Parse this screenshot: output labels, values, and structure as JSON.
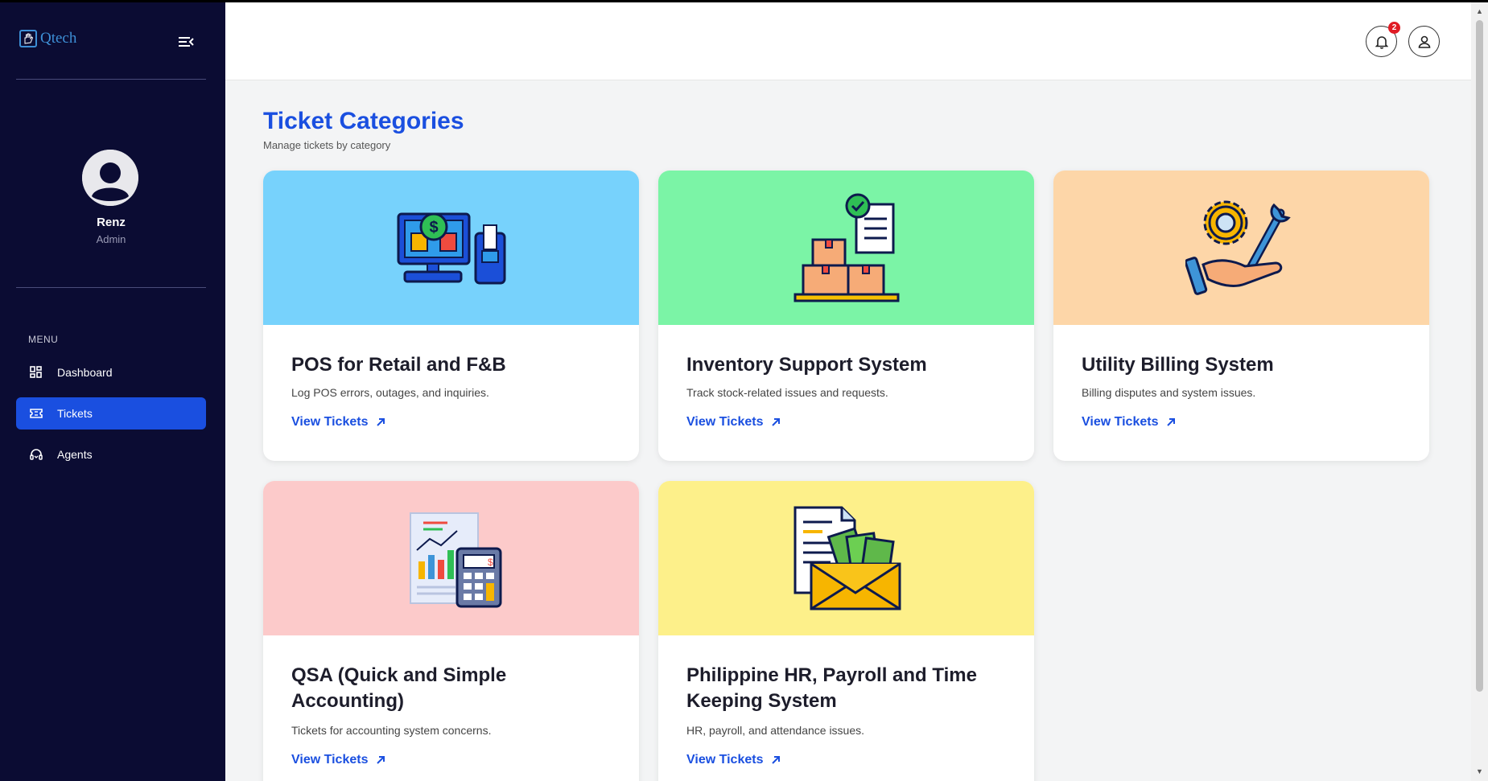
{
  "app": {
    "logo_text": "Qtech"
  },
  "user": {
    "name": "Renz",
    "role": "Admin"
  },
  "menu": {
    "label": "MENU",
    "items": [
      {
        "label": "Dashboard",
        "icon": "grid-icon",
        "active": false
      },
      {
        "label": "Tickets",
        "icon": "ticket-icon",
        "active": true
      },
      {
        "label": "Agents",
        "icon": "headset-icon",
        "active": false
      }
    ]
  },
  "topbar": {
    "notification_count": "2"
  },
  "page": {
    "title": "Ticket Categories",
    "subtitle": "Manage tickets by category"
  },
  "categories": [
    {
      "title": "POS for Retail and F&B",
      "description": "Log POS errors, outages, and inquiries.",
      "link": "View Tickets",
      "color": "#77d2fc",
      "illustration": "pos-terminal-icon"
    },
    {
      "title": "Inventory Support System",
      "description": "Track stock-related issues and requests.",
      "link": "View Tickets",
      "color": "#7bf4a6",
      "illustration": "inventory-boxes-icon"
    },
    {
      "title": "Utility Billing System",
      "description": "Billing disputes and system issues.",
      "link": "View Tickets",
      "color": "#fdd6a8",
      "illustration": "gear-wrench-hand-icon"
    },
    {
      "title": "QSA (Quick and Simple Accounting)",
      "description": "Tickets for accounting system concerns.",
      "link": "View Tickets",
      "color": "#fccaca",
      "illustration": "accounting-calculator-icon"
    },
    {
      "title": "Philippine HR, Payroll and Time Keeping System",
      "description": "HR, payroll, and attendance issues.",
      "link": "View Tickets",
      "color": "#fdf08a",
      "illustration": "payroll-envelope-icon"
    }
  ]
}
